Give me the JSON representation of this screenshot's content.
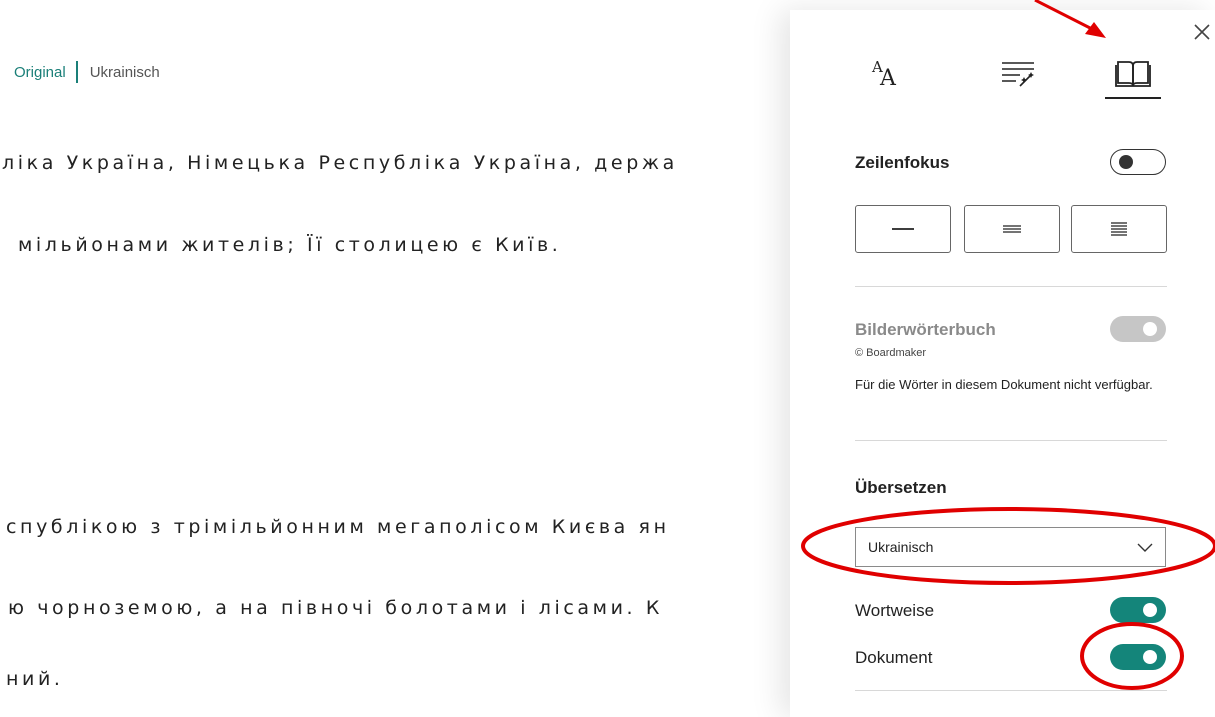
{
  "reader": {
    "original_label": "Original",
    "translated_label": "Ukrainisch",
    "lines": [
      "ліка Україна, Німецька Республіка Україна, держа",
      "мільйонами жителів; Її столицею є Київ.",
      "спублікою з трімільйонним мегаполісом Києва ян",
      "ю чорноземою, а на півночі болотами і лісами. К",
      "ний."
    ]
  },
  "panel": {
    "tabs": [
      {
        "name": "text-options",
        "icon": "font-size-icon"
      },
      {
        "name": "grammar-options",
        "icon": "grammar-wand-icon"
      },
      {
        "name": "reading-preferences",
        "icon": "open-book-icon",
        "selected": true
      }
    ],
    "line_focus": {
      "title": "Zeilenfokus",
      "enabled": false,
      "options": [
        "one-line",
        "three-lines",
        "five-lines"
      ]
    },
    "picture_dictionary": {
      "title": "Bilderwörterbuch",
      "copyright": "© Boardmaker",
      "note": "Für die Wörter in diesem Dokument nicht verfügbar.",
      "enabled": true,
      "disabled": true
    },
    "translate": {
      "title": "Übersetzen",
      "selected_language": "Ukrainisch",
      "by_word_label": "Wortweise",
      "by_word_enabled": true,
      "document_label": "Dokument",
      "document_enabled": true
    },
    "close_icon": "close-icon"
  },
  "colors": {
    "accent": "#14857a",
    "link": "#1a7f78",
    "annotation": "#e00000"
  }
}
